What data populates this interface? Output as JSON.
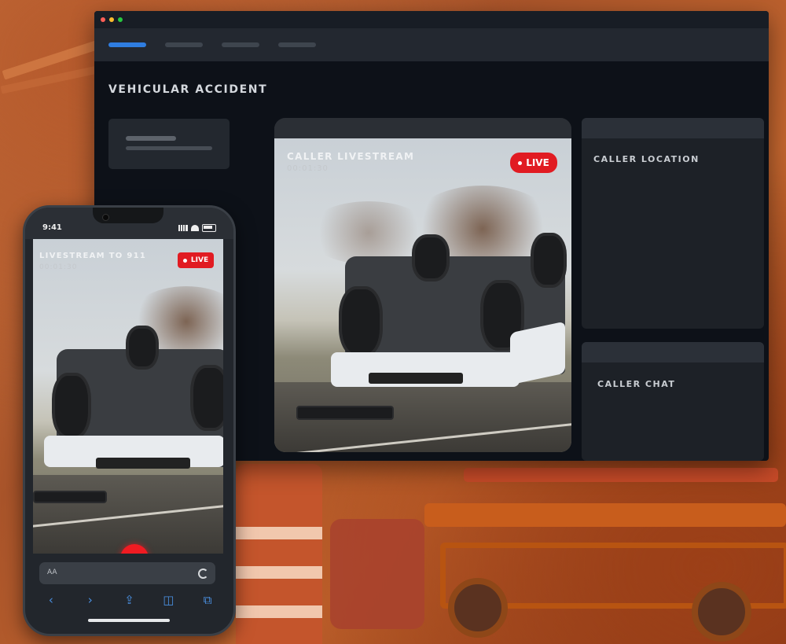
{
  "dashboard": {
    "incident_title": "VEHICULAR ACCIDENT",
    "video_panel": {
      "title": "CALLER LIVESTREAM",
      "timer": "00:01:30",
      "live_label": "LIVE"
    },
    "location_card": {
      "label": "CALLER LOCATION"
    },
    "chat_card": {
      "label": "CALLER CHAT"
    }
  },
  "phone": {
    "clock": "9:41",
    "stream_title": "LIVESTREAM TO 911",
    "timer": "00:01:30",
    "live_label": "LIVE",
    "url_bar_text": "AA"
  },
  "colors": {
    "live_red": "#e11b22",
    "active_tab": "#2f7de0",
    "window_bg": "#0d1118"
  },
  "icons": [
    "back-icon",
    "forward-icon",
    "share-icon",
    "bookmarks-icon",
    "tabs-icon",
    "reload-icon"
  ]
}
